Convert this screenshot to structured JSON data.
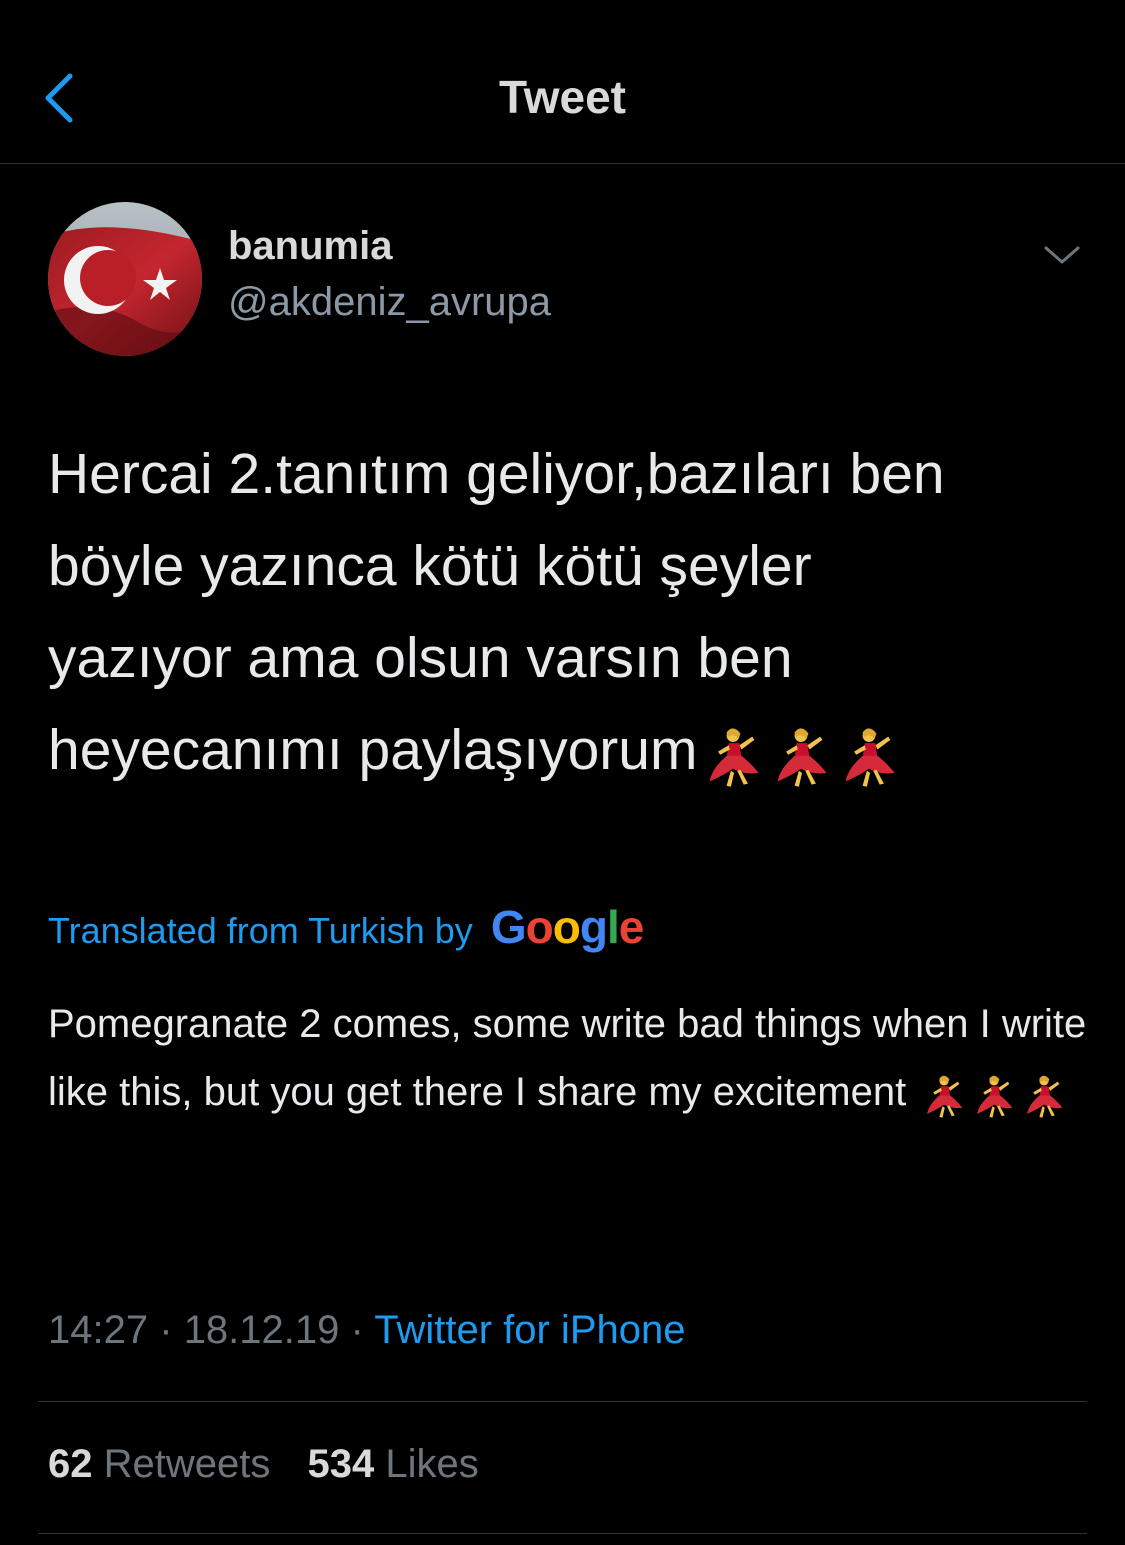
{
  "colors": {
    "background": "#000000",
    "accent": "#1d9bf0",
    "primary_text": "#e7e9ea",
    "secondary_text": "#6e767d",
    "divider": "#2f3336"
  },
  "navbar": {
    "back_icon": "chevron-left-icon",
    "title": "Tweet"
  },
  "author": {
    "avatar_icon": "turkish-flag-avatar",
    "display_name": "banumia",
    "handle": "@akdeniz_avrupa",
    "menu_icon": "chevron-down-icon"
  },
  "tweet": {
    "text": "Hercai 2.tanıtım geliyor,bazıları ben\nböyle yazınca kötü kötü şeyler\nyazıyor ama olsun varsın ben\nheyecanımı paylaşıyorum",
    "emoji_icon": "dancing-woman-emoji"
  },
  "translation": {
    "label": "Translated from Turkish by",
    "provider": "Google",
    "text": "Pomegranate 2 comes, some write bad things when I write like this, but you get there I share my excitement"
  },
  "meta": {
    "time": "14:27",
    "date": "18.12.19",
    "separator": "·",
    "source": "Twitter for iPhone"
  },
  "stats": {
    "retweets_count": "62",
    "retweets_label": "Retweets",
    "likes_count": "534",
    "likes_label": "Likes"
  }
}
